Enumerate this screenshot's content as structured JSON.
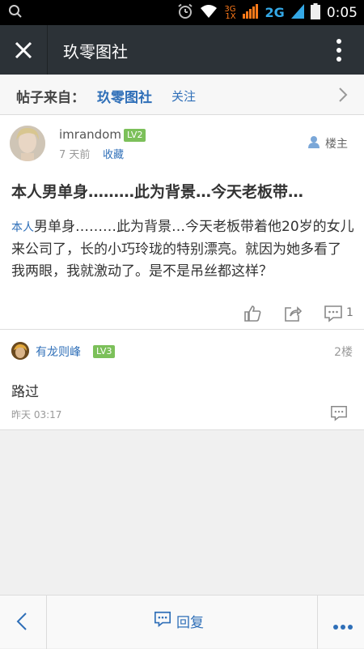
{
  "status_bar": {
    "network_small": "3G",
    "network_small2": "1X",
    "network": "2G",
    "time": "0:05",
    "icons": [
      "search-icon",
      "alarm-icon",
      "wifi-icon",
      "signal-icon",
      "battery-icon"
    ]
  },
  "titlebar": {
    "title": "玖零图社",
    "close_icon": "close-icon",
    "more_icon": "more-vertical-icon"
  },
  "source": {
    "label": "帖子来自：",
    "forum": "玖零图社",
    "follow": "关注"
  },
  "post": {
    "username": "imrandom",
    "level": "LV2",
    "time": "7 天前",
    "favorite": "收藏",
    "louzhu": "楼主",
    "title": "本人男单身………此为背景…今天老板带…",
    "content_tag": "本人",
    "content": "男单身………此为背景…今天老板带着他20岁的女儿来公司了，长的小巧玲珑的特别漂亮。就因为她多看了我两眼，我就激动了。是不是吊丝都这样？",
    "comment_count": "1"
  },
  "reply": {
    "username": "有龙则峰",
    "level": "LV3",
    "floor": "2楼",
    "text": "路过",
    "time": "昨天 03:17"
  },
  "bottom": {
    "reply_label": "回复"
  },
  "colors": {
    "accent": "#2f6fb8",
    "titlebar": "#2c3237",
    "level_badge": "#7cc05a"
  }
}
